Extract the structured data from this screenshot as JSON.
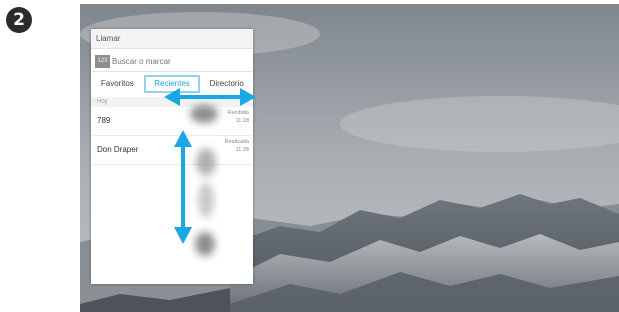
{
  "step_number": "2",
  "dialog": {
    "title": "Llamar",
    "keypad_label": "123",
    "search_placeholder": "Buscar o marcar",
    "tabs": [
      {
        "label": "Favoritos",
        "active": false
      },
      {
        "label": "Recientes",
        "active": true
      },
      {
        "label": "Directorio",
        "active": false
      }
    ],
    "section_label": "Hoy",
    "calls": [
      {
        "name": "789",
        "status": "Recibida",
        "time": "11:28"
      },
      {
        "name": "Don Draper",
        "status": "Realizada",
        "time": "11:28"
      }
    ]
  },
  "colors": {
    "accent": "#1ea6e0",
    "arrow": "#19a7e6",
    "badge": "#2b2b2b"
  },
  "icons": [
    "swipe-horizontal-icon",
    "swipe-vertical-icon"
  ]
}
